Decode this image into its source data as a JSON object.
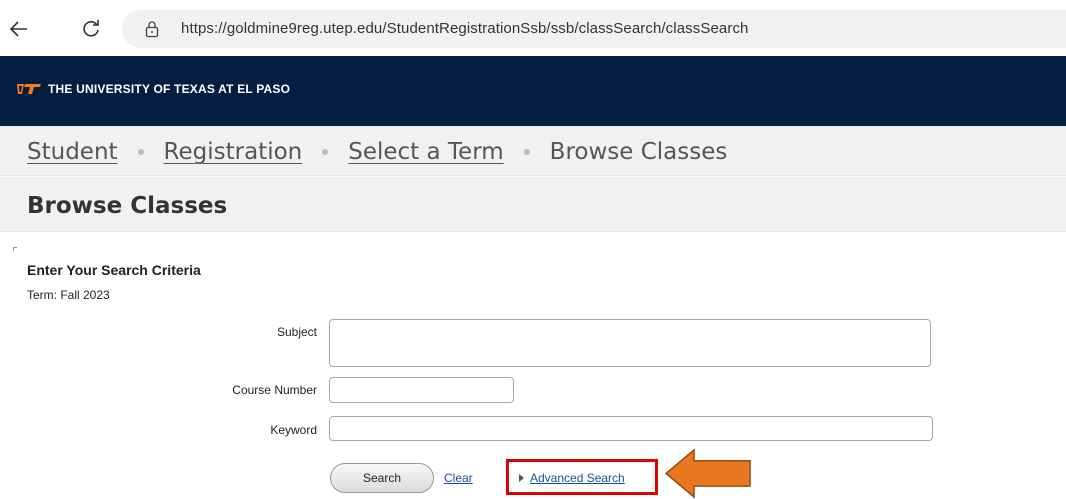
{
  "browser": {
    "url": "https://goldmine9reg.utep.edu/StudentRegistrationSsb/ssb/classSearch/classSearch",
    "icons": [
      "back-arrow-icon",
      "reload-icon",
      "lock-icon"
    ]
  },
  "header": {
    "logo_icon": "utep-logo-icon",
    "site_name": "THE UNIVERSITY OF TEXAS AT EL PASO"
  },
  "breadcrumb": {
    "student": "Student",
    "registration": "Registration",
    "select_term": "Select a Term",
    "current": "Browse Classes"
  },
  "page": {
    "title": "Browse Classes"
  },
  "search_form": {
    "heading": "Enter Your Search Criteria",
    "term_line": "Term: Fall 2023",
    "subject_label": "Subject",
    "subject_value": "",
    "course_number_label": "Course Number",
    "course_number_value": "",
    "keyword_label": "Keyword",
    "keyword_value": "",
    "search_button": "Search",
    "clear_link": "Clear",
    "advanced_search_link": "Advanced Search"
  },
  "annotation": {
    "highlight_color": "#e00000",
    "arrow_color": "#e87722",
    "arrow_icon": "left-arrow-callout-icon"
  },
  "colors": {
    "header_bg": "#041e42",
    "link": "#1a4f9b",
    "bar_bg": "#f1f1f1"
  }
}
